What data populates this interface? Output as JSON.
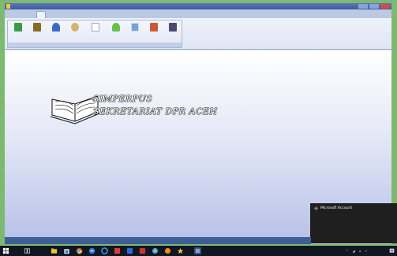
{
  "window": {
    "title": "",
    "controls": [
      "minimize",
      "maximize",
      "close"
    ]
  },
  "menu": {
    "tabs": [
      {
        "label": "",
        "active": false
      },
      {
        "label": "",
        "active": false
      },
      {
        "label": "",
        "active": false
      },
      {
        "label": "",
        "active": true
      }
    ]
  },
  "ribbon": {
    "group_label": "",
    "buttons": [
      {
        "label": "",
        "icon": "chart-report-icon",
        "color": "#3a9a4a"
      },
      {
        "label": "",
        "icon": "book-report-icon",
        "color": "#8a6a2a"
      },
      {
        "label": "",
        "icon": "member-report-icon",
        "color": "#3a6ac8"
      },
      {
        "label": "",
        "icon": "borrow-report-icon",
        "color": "#d8b070"
      },
      {
        "label": "",
        "icon": "document-report-icon",
        "color": "#ffffff"
      },
      {
        "label": "",
        "icon": "people-report-icon",
        "color": "#6abf4a"
      },
      {
        "label": "",
        "icon": "visitor-report-icon",
        "color": "#7aa0d8"
      },
      {
        "label": "",
        "icon": "stock-report-icon",
        "color": "#c85a3a"
      },
      {
        "label": "",
        "icon": "fine-report-icon",
        "color": "#4a4a6a"
      }
    ]
  },
  "main": {
    "logo_icon": "open-book-icon",
    "title_line1": "SIMPERPUS",
    "title_line2": "SEKRETARIAT DPR ACEH"
  },
  "notification": {
    "title": "Microsoft Account",
    "icon": "gear-icon",
    "body": ""
  },
  "statusbar": {
    "text": ""
  },
  "taskbar": {
    "icons": [
      "start-icon",
      "task-view-icon",
      "file-explorer-icon",
      "store-icon",
      "chrome-icon",
      "edge-icon",
      "ie-icon",
      "app-red-icon",
      "app-blue-icon",
      "app-red2-icon",
      "app-paint-icon",
      "app-globe-icon",
      "app-star-icon",
      "app-current-icon"
    ],
    "tray_text": "",
    "time": "",
    "date": ""
  },
  "colors": {
    "accent": "#3d5a9c",
    "desktop_green": "#7db96f",
    "toast_bg": "#1f1f1f",
    "taskbar_bg": "#101622"
  }
}
